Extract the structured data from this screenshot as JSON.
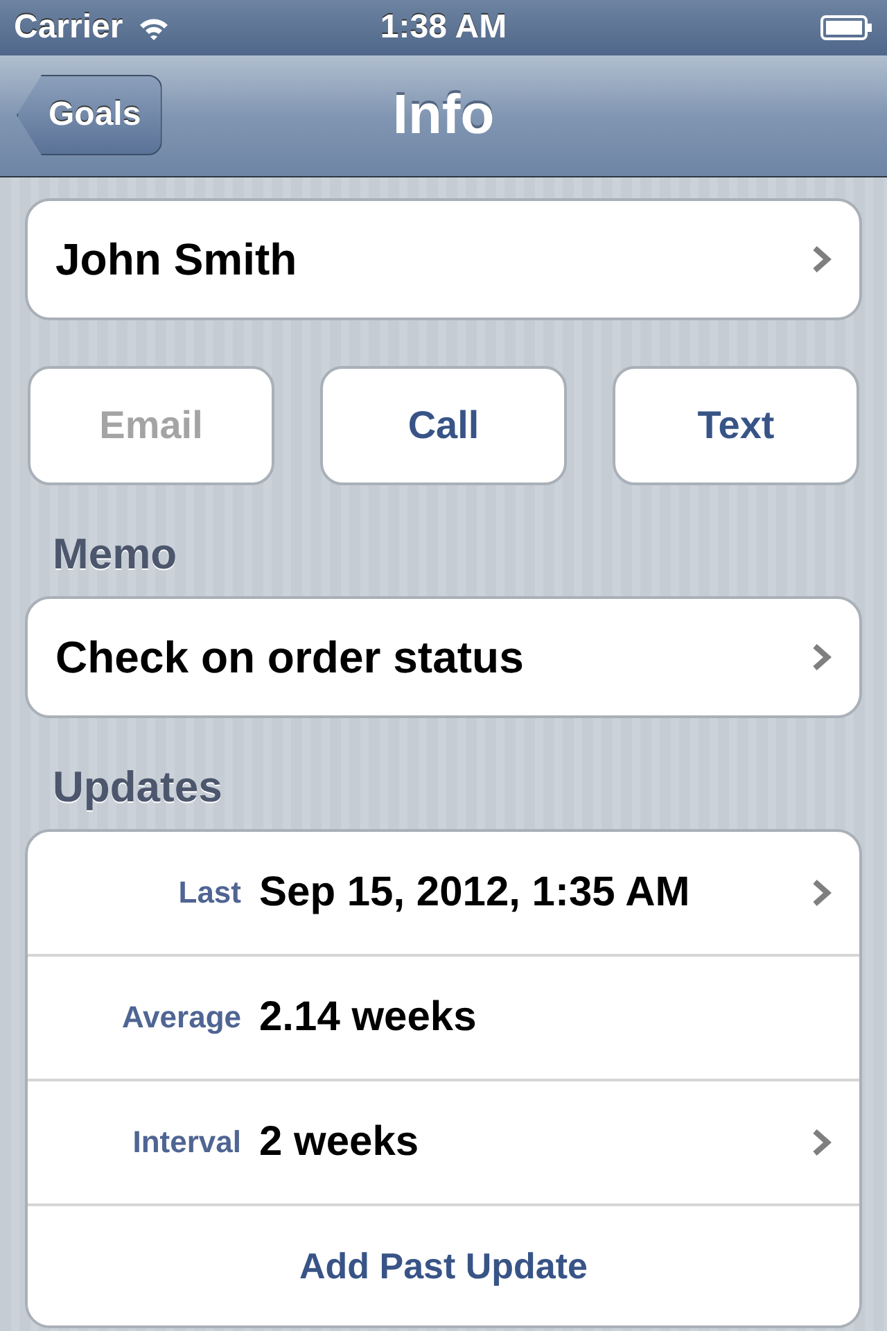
{
  "status_bar": {
    "carrier": "Carrier",
    "time": "1:38 AM"
  },
  "nav": {
    "back": "Goals",
    "title": "Info"
  },
  "contact": {
    "name": "John Smith",
    "disclosure": true
  },
  "actions": [
    {
      "label": "Email",
      "disabled": true
    },
    {
      "label": "Call",
      "disabled": false
    },
    {
      "label": "Text",
      "disabled": false
    }
  ],
  "memo": {
    "header": "Memo",
    "text": "Check on order status",
    "disclosure": true
  },
  "updates": {
    "header": "Updates",
    "rows": [
      {
        "label": "Last",
        "value": "Sep 15, 2012, 1:35 AM",
        "disclosure": true
      },
      {
        "label": "Average",
        "value": "2.14 weeks",
        "disclosure": false
      },
      {
        "label": "Interval",
        "value": "2 weeks",
        "disclosure": true
      }
    ],
    "add_button": "Add Past Update"
  }
}
